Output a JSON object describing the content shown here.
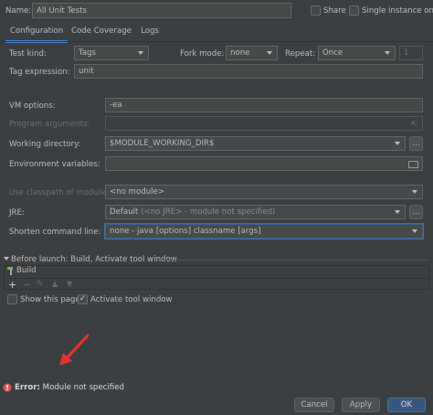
{
  "header": {
    "name_label": "Name:",
    "name_value": "All Unit Tests",
    "share_label": "Share",
    "single_instance_label": "Single instance only"
  },
  "tabs": [
    {
      "label": "Configuration",
      "active": true
    },
    {
      "label": "Code Coverage",
      "active": false
    },
    {
      "label": "Logs",
      "active": false
    }
  ],
  "form": {
    "test_kind_label": "Test kind:",
    "test_kind_value": "Tags",
    "fork_mode_label": "Fork mode:",
    "fork_mode_value": "none",
    "repeat_label": "Repeat:",
    "repeat_value": "Once",
    "repeat_count": "1",
    "tag_expression_label": "Tag expression:",
    "tag_expression_value": "unit",
    "vm_options_label": "VM options:",
    "vm_options_value": "-ea",
    "program_arguments_label": "Program arguments:",
    "working_directory_label": "Working directory:",
    "working_directory_value": "$MODULE_WORKING_DIR$",
    "environment_variables_label": "Environment variables:",
    "classpath_label": "Use classpath of module:",
    "classpath_value": "<no module>",
    "jre_label": "JRE:",
    "jre_value_prefix": "Default",
    "jre_value_rest": "(<no JRE> - module not specified)",
    "shorten_label": "Shorten command line:",
    "shorten_value": "none - java [options] classname [args]",
    "browse_label": "..."
  },
  "before_launch": {
    "header": "Before launch: Build, Activate tool window",
    "items": [
      "Build"
    ],
    "show_page_label": "Show this page",
    "activate_tool_label": "Activate tool window"
  },
  "error": {
    "prefix": "Error:",
    "message": "Module not specified"
  },
  "buttons": {
    "cancel": "Cancel",
    "apply": "Apply",
    "ok": "OK"
  },
  "colors": {
    "background": "#3c3f41",
    "field": "#45494a",
    "accent": "#4a88c7",
    "error": "#e05555",
    "arrow": "#e8322c"
  },
  "icons": [
    "folder-icon",
    "build-hammer-icon",
    "error-icon",
    "plus-icon",
    "minus-icon",
    "edit-icon",
    "up-icon",
    "down-icon"
  ]
}
